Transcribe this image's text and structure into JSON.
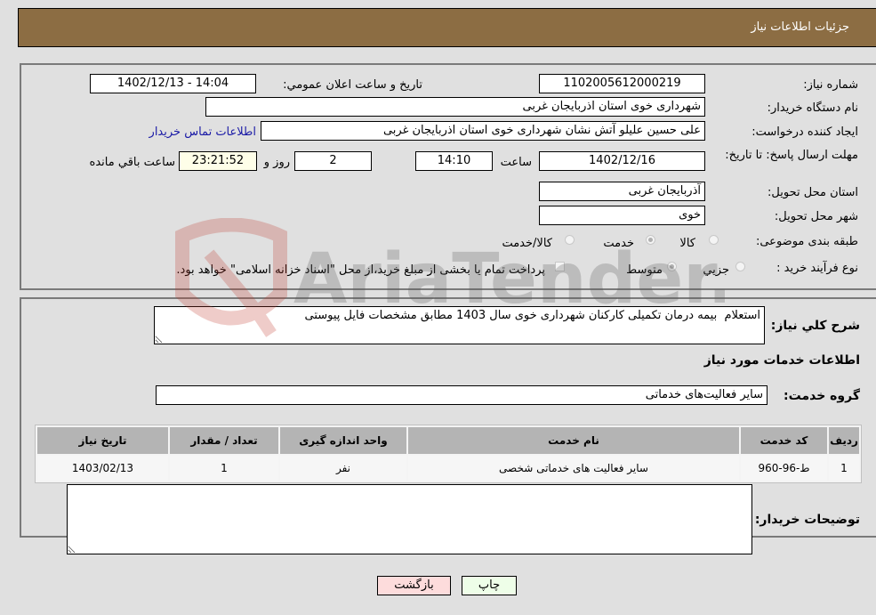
{
  "header": {
    "title": "جزئیات اطلاعات نیاز"
  },
  "form": {
    "need_number_label": "شماره نیاز:",
    "need_number": "1102005612000219",
    "announce_label": "تاریخ و ساعت اعلان عمومي:",
    "announce_value": "1402/12/13 - 14:04",
    "buyer_org_label": "نام دستگاه خریدار:",
    "buyer_org": "شهرداری خوی استان اذربایجان غربی",
    "creator_label": "ایجاد کننده درخواست:",
    "creator": "علی حسین علیلو آتش نشان شهرداری خوی استان اذربایجان غربی",
    "contact_link": "اطلاعات تماس خریدار",
    "deadline_label": "مهلت ارسال پاسخ: تا تاریخ:",
    "deadline_date": "1402/12/16",
    "time_label": "ساعت",
    "deadline_time": "14:10",
    "days": "2",
    "days_label": "روز و",
    "remaining": "23:21:52",
    "remaining_label": "ساعت باقي مانده",
    "province_label": "استان محل تحویل:",
    "province": "آذربایجان غربی",
    "city_label": "شهر محل تحویل:",
    "city": "خوی",
    "category_label": "طبقه بندی موضوعی:",
    "category_options": [
      {
        "label": "کالا",
        "checked": false
      },
      {
        "label": "خدمت",
        "checked": true
      },
      {
        "label": "کالا/خدمت",
        "checked": false
      }
    ],
    "process_label": "نوع فرآیند خرید :",
    "process_options": [
      {
        "label": "جزیي",
        "checked": false
      },
      {
        "label": "متوسط",
        "checked": true
      }
    ],
    "treasury_note": "پرداخت تمام یا بخشی از مبلغ خرید،از محل \"اسناد خزانه اسلامی\" خواهد بود."
  },
  "details": {
    "description_label": "شرح کلي نیاز:",
    "description": "استعلام  بیمه درمان تکمیلی کارکنان شهرداری خوی سال 1403 مطابق مشخصات فایل پیوستی",
    "services_heading": "اطلاعات خدمات مورد نیاز",
    "service_group_label": "گروه خدمت:",
    "service_group": "سایر فعالیت‌های خدماتی",
    "table": {
      "headers": [
        "ردیف",
        "کد خدمت",
        "نام خدمت",
        "واحد اندازه گیری",
        "تعداد / مقدار",
        "تاریخ نیاز"
      ],
      "rows": [
        [
          "1",
          "ط-96-960",
          "سایر فعالیت های خدماتی شخصی",
          "نفر",
          "1",
          "1403/02/13"
        ]
      ]
    },
    "buyer_notes_label": "توضیحات خریدار:",
    "buyer_notes": ""
  },
  "buttons": {
    "print": "چاپ",
    "back": "بازگشت"
  },
  "watermark": {
    "text": "AriaTender.neT"
  }
}
